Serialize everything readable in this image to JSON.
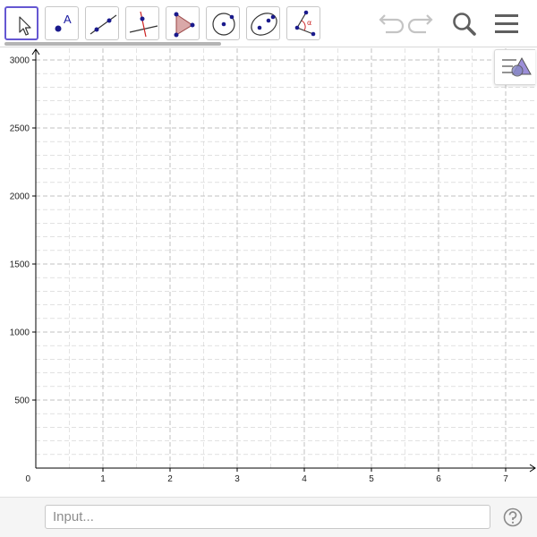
{
  "toolbar": {
    "tools": [
      {
        "name": "Move",
        "icon": "move-arrow-icon",
        "selected": true
      },
      {
        "name": "Point",
        "icon": "point-icon"
      },
      {
        "name": "Line",
        "icon": "line-icon"
      },
      {
        "name": "Perpendicular Line",
        "icon": "perpendicular-line-icon"
      },
      {
        "name": "Polygon",
        "icon": "polygon-icon"
      },
      {
        "name": "Circle with Center through Point",
        "icon": "circle-center-point-icon"
      },
      {
        "name": "Ellipse",
        "icon": "ellipse-icon"
      },
      {
        "name": "Angle",
        "icon": "angle-icon"
      }
    ],
    "point_tool_letter": "A",
    "angle_tool_symbol": "α",
    "header_icons": [
      "undo-icon",
      "redo-icon",
      "search-icon",
      "menu-icon"
    ],
    "style_bar_icon": "style-bar-toggle-icon"
  },
  "graphics": {
    "x_ticks": [
      "1",
      "2",
      "3",
      "4",
      "5",
      "6",
      "7"
    ],
    "y_ticks": [
      "500",
      "1000",
      "1500",
      "2000",
      "2500",
      "3000"
    ],
    "origin_label": "0",
    "x_range": [
      0,
      7.4
    ],
    "y_range": [
      0,
      3000
    ],
    "grid": true
  },
  "input_bar": {
    "placeholder": "Input...",
    "value": "",
    "help_icon": "help-icon"
  },
  "colors": {
    "accent": "#6557d2",
    "point": "#1a1a8c",
    "polygon_fill": "#d9a8a8",
    "grid": "#c0c0c0",
    "axis": "#000000"
  }
}
